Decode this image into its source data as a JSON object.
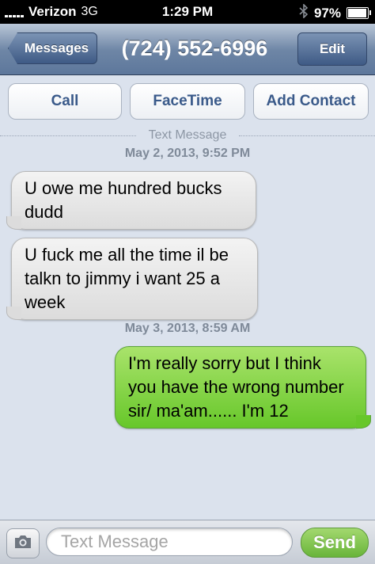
{
  "status_bar": {
    "carrier": "Verizon",
    "network": "3G",
    "time": "1:29 PM",
    "battery_percent": "97%",
    "battery_level": 0.97,
    "icons": [
      "signal-icon",
      "bluetooth-icon",
      "battery-icon"
    ]
  },
  "nav": {
    "back_label": "Messages",
    "title": "(724) 552-6996",
    "edit_label": "Edit"
  },
  "actions": {
    "call": "Call",
    "facetime": "FaceTime",
    "add_contact": "Add Contact"
  },
  "thread": {
    "divider_label": "Text Message",
    "messages": [
      {
        "timestamp": "May 2, 2013, 9:52 PM"
      },
      {
        "direction": "incoming",
        "text": "U owe me hundred bucks dudd"
      },
      {
        "direction": "incoming",
        "text": "U fuck me all the time il be talkn to jimmy i want 25 a week"
      },
      {
        "timestamp": "May 3, 2013, 8:59 AM"
      },
      {
        "direction": "outgoing",
        "text": "I'm really sorry but I think you have the wrong number sir/ ma'am...... I'm 12"
      }
    ]
  },
  "composer": {
    "placeholder": "Text Message",
    "value": "",
    "send_label": "Send",
    "camera_icon": "camera-icon"
  },
  "colors": {
    "incoming_bubble": "#dcdcdc",
    "outgoing_bubble": "#67c72a",
    "nav_bar": "#6e86a6"
  }
}
